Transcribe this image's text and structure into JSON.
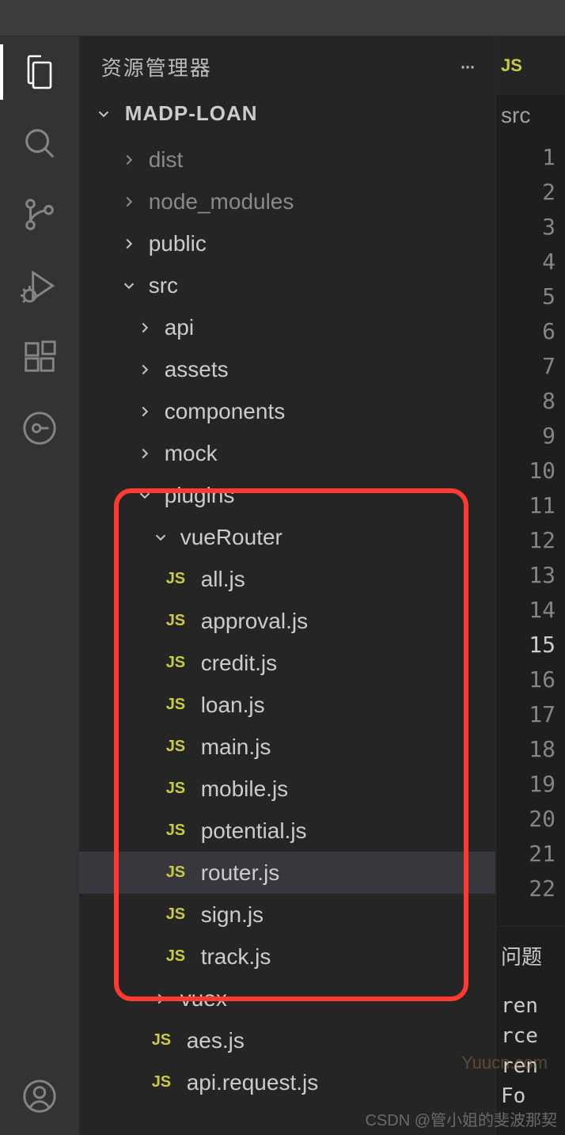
{
  "sidebar": {
    "title": "资源管理器",
    "project": "MADP-LOAN"
  },
  "tree": {
    "dist": "dist",
    "node_modules": "node_modules",
    "public": "public",
    "src": "src",
    "api": "api",
    "assets": "assets",
    "components": "components",
    "mock": "mock",
    "plugins": "plugins",
    "vueRouter": "vueRouter",
    "files": {
      "all": "all.js",
      "approval": "approval.js",
      "credit": "credit.js",
      "loan": "loan.js",
      "main": "main.js",
      "mobile": "mobile.js",
      "potential": "potential.js",
      "router": "router.js",
      "sign": "sign.js",
      "track": "track.js"
    },
    "vuex": "vuex",
    "aes": "aes.js",
    "apirequest": "api.request.js"
  },
  "editor": {
    "tab_icon": "JS",
    "breadcrumb": "src",
    "line_start": 1,
    "line_end": 22,
    "current_line": 15
  },
  "panel": {
    "tab": "问题",
    "terminal": [
      "ren",
      "rce",
      "ren",
      "Fo"
    ]
  },
  "js_label": "JS",
  "watermark": "CSDN @管小姐的斐波那契",
  "watermark2": "Yuucn.com"
}
